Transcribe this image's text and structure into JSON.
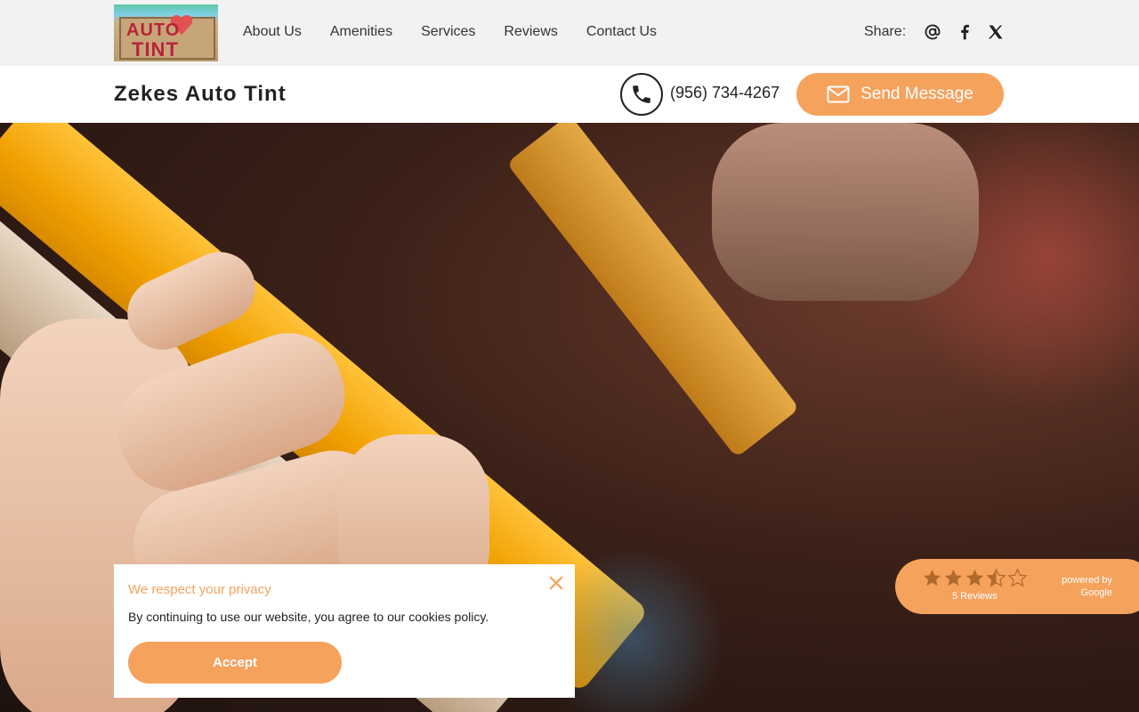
{
  "header": {
    "logo_text_top": "AUTO",
    "logo_text_bottom": "TINT",
    "nav": [
      "About Us",
      "Amenities",
      "Services",
      "Reviews",
      "Contact Us"
    ],
    "share_label": "Share:",
    "share_icons": [
      "at-icon",
      "facebook-icon",
      "x-icon"
    ]
  },
  "bar": {
    "brand": "Zekes Auto Tint",
    "phone": "(956) 734-4267",
    "send_label": "Send Message"
  },
  "cookie": {
    "title": "We respect your privacy",
    "text": "By continuing to use our website, you agree to our cookies policy.",
    "accept_label": "Accept"
  },
  "reviews": {
    "rating": 3.5,
    "count_label": "5 Reviews",
    "powered_line1": "powered by",
    "powered_line2": "Google"
  },
  "colors": {
    "accent": "#f5a25d",
    "nav_bg": "#f2f2f2"
  }
}
